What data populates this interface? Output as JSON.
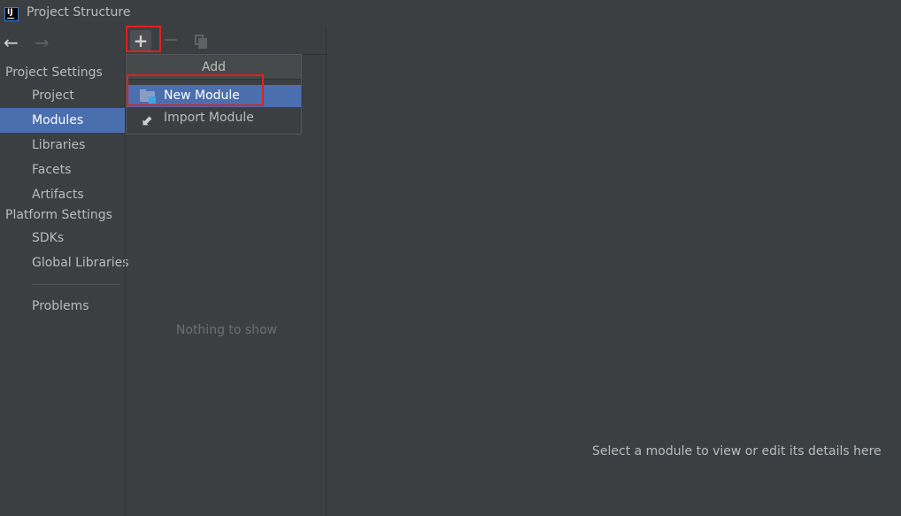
{
  "window": {
    "title": "Project Structure"
  },
  "nav": {
    "back_icon": "←",
    "forward_icon": "→"
  },
  "sidebar": {
    "project_settings_header": "Project Settings",
    "project_settings_items": [
      {
        "label": "Project",
        "selected": false
      },
      {
        "label": "Modules",
        "selected": true
      },
      {
        "label": "Libraries",
        "selected": false
      },
      {
        "label": "Facets",
        "selected": false
      },
      {
        "label": "Artifacts",
        "selected": false
      }
    ],
    "platform_settings_header": "Platform Settings",
    "platform_settings_items": [
      {
        "label": "SDKs"
      },
      {
        "label": "Global Libraries"
      }
    ],
    "problems_label": "Problems"
  },
  "toolbar": {
    "add_icon": "+",
    "remove_icon": "−"
  },
  "modules_panel": {
    "empty_text": "Nothing to show"
  },
  "add_popup": {
    "title": "Add",
    "items": [
      {
        "label": "New Module",
        "icon": "module-folder-icon",
        "selected": true
      },
      {
        "label": "Import Module",
        "icon": "import-arrow-icon",
        "selected": false
      }
    ]
  },
  "details_panel": {
    "hint": "Select a module to view or edit its details here"
  },
  "colors": {
    "background": "#3c3f41",
    "selection": "#4b6eaf",
    "highlight_box": "#e02020",
    "text": "#bbbbbb"
  }
}
